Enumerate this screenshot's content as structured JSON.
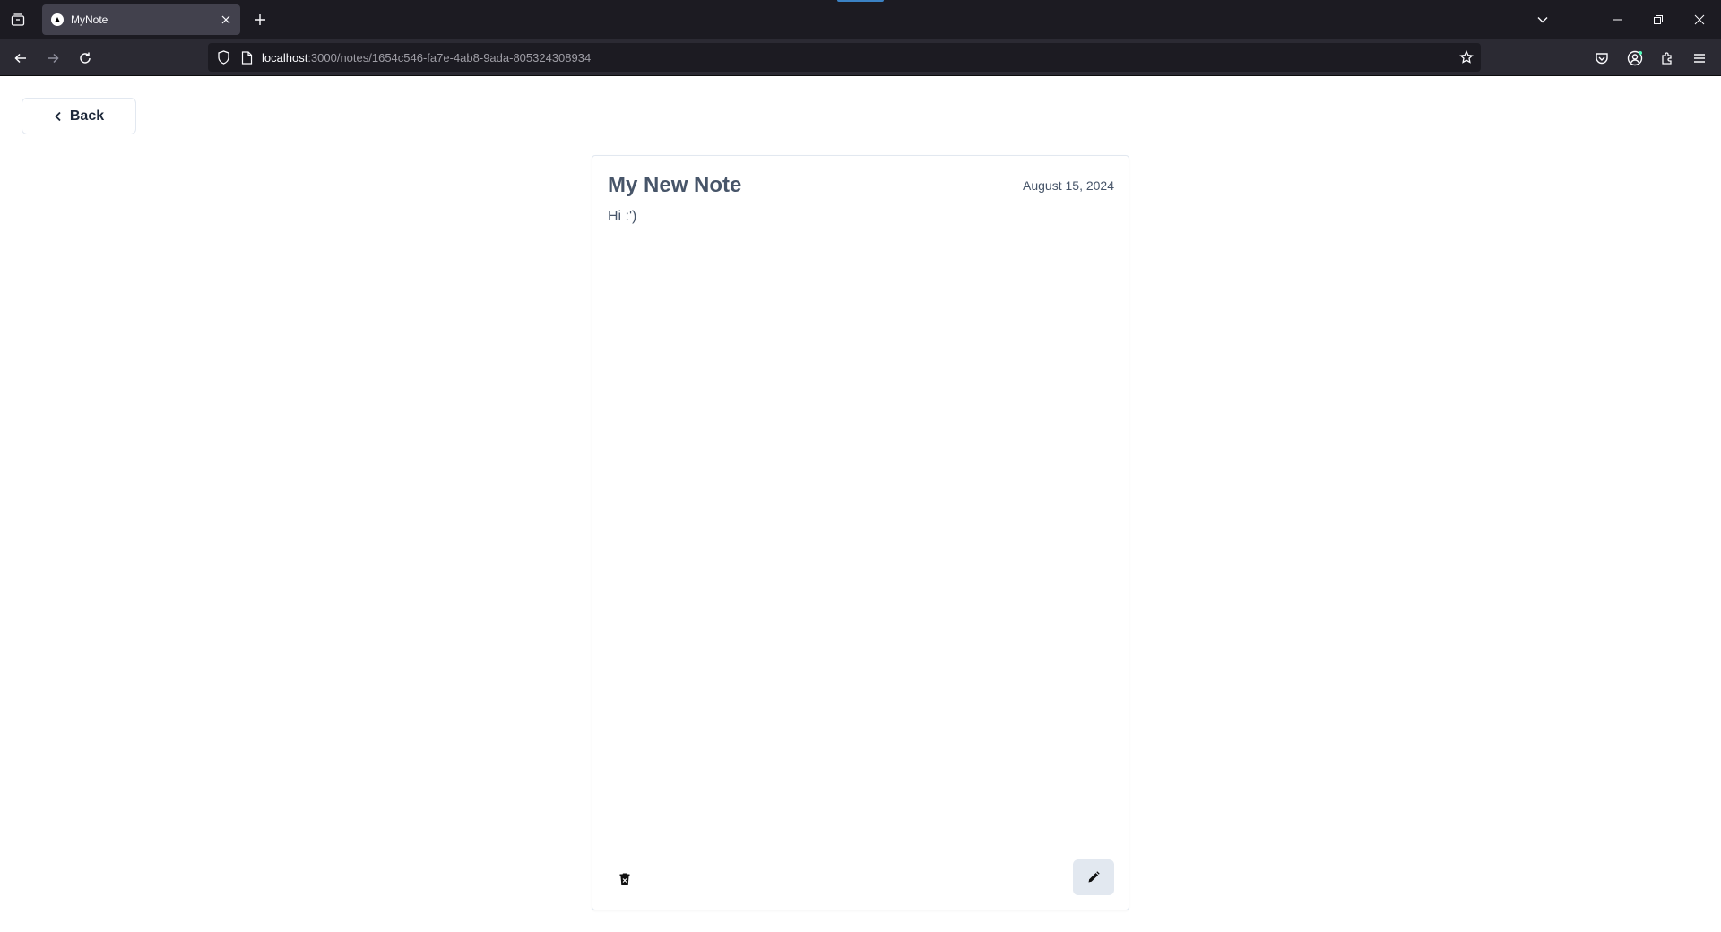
{
  "browser": {
    "tab": {
      "title": "MyNote",
      "favicon": "nextjs-triangle-icon"
    },
    "url": {
      "host": "localhost",
      "path": ":3000/notes/1654c546-fa7e-4ab8-9ada-805324308934"
    },
    "icons": [
      "tab-list-icon",
      "close-tab-icon",
      "new-tab-icon",
      "list-all-tabs-icon",
      "minimize-icon",
      "restore-icon",
      "close-window-icon",
      "back-arrow-icon",
      "forward-arrow-icon",
      "reload-icon",
      "shield-icon",
      "page-icon",
      "bookmark-star-icon",
      "pocket-icon",
      "account-icon",
      "extensions-icon",
      "menu-icon"
    ]
  },
  "page": {
    "back_label": "Back",
    "note": {
      "title": "My New Note",
      "date": "August 15, 2024",
      "content": "Hi :')"
    }
  },
  "colors": {
    "chrome_dark": "#1c1b22",
    "toolbar": "#2b2a33",
    "active_tab": "#42414d",
    "text_slate": "#475569",
    "card_border": "#e2e8f0",
    "edit_button_bg": "#e2e8f0"
  }
}
